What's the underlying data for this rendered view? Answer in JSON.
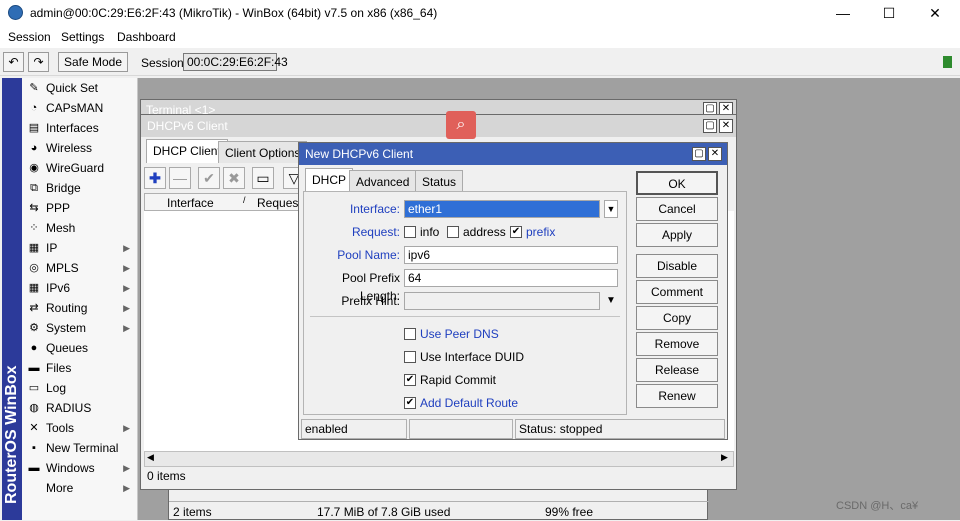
{
  "window": {
    "title": "admin@00:0C:29:E6:2F:43 (MikroTik) - WinBox (64bit) v7.5 on x86 (x86_64)",
    "minimize": "—",
    "maximize": "☐",
    "close": "✕"
  },
  "menu": [
    "Session",
    "Settings",
    "Dashboard"
  ],
  "toolbar": {
    "undo": "↶",
    "redo": "↷",
    "safe_mode": "Safe Mode",
    "session_label": "Session:",
    "session_value": "00:0C:29:E6:2F:43"
  },
  "brand_vertical": "RouterOS WinBox",
  "sidebar": [
    {
      "label": "Quick Set",
      "icon": "wand-icon",
      "glyph": "✎",
      "arrow": ""
    },
    {
      "label": "CAPsMAN",
      "icon": "capsman-icon",
      "glyph": "◔",
      "arrow": ""
    },
    {
      "label": "Interfaces",
      "icon": "interfaces-icon",
      "glyph": "▤",
      "arrow": ""
    },
    {
      "label": "Wireless",
      "icon": "wireless-icon",
      "glyph": "◕",
      "arrow": ""
    },
    {
      "label": "WireGuard",
      "icon": "wireguard-icon",
      "glyph": "◉",
      "arrow": ""
    },
    {
      "label": "Bridge",
      "icon": "bridge-icon",
      "glyph": "⧉",
      "arrow": ""
    },
    {
      "label": "PPP",
      "icon": "ppp-icon",
      "glyph": "⇆",
      "arrow": ""
    },
    {
      "label": "Mesh",
      "icon": "mesh-icon",
      "glyph": "⁘",
      "arrow": ""
    },
    {
      "label": "IP",
      "icon": "ip-icon",
      "glyph": "▦",
      "arrow": "▶"
    },
    {
      "label": "MPLS",
      "icon": "mpls-icon",
      "glyph": "◎",
      "arrow": "▶"
    },
    {
      "label": "IPv6",
      "icon": "ipv6-icon",
      "glyph": "▦",
      "arrow": "▶"
    },
    {
      "label": "Routing",
      "icon": "routing-icon",
      "glyph": "⇄",
      "arrow": "▶"
    },
    {
      "label": "System",
      "icon": "gear-icon",
      "glyph": "⚙",
      "arrow": "▶"
    },
    {
      "label": "Queues",
      "icon": "queues-icon",
      "glyph": "●",
      "arrow": ""
    },
    {
      "label": "Files",
      "icon": "files-icon",
      "glyph": "▬",
      "arrow": ""
    },
    {
      "label": "Log",
      "icon": "log-icon",
      "glyph": "▭",
      "arrow": ""
    },
    {
      "label": "RADIUS",
      "icon": "radius-icon",
      "glyph": "◍",
      "arrow": ""
    },
    {
      "label": "Tools",
      "icon": "tools-icon",
      "glyph": "✕",
      "arrow": "▶"
    },
    {
      "label": "New Terminal",
      "icon": "terminal-icon",
      "glyph": "▪",
      "arrow": ""
    },
    {
      "label": "Windows",
      "icon": "windows-icon",
      "glyph": "▬",
      "arrow": "▶"
    },
    {
      "label": "More",
      "icon": "more-icon",
      "glyph": "",
      "arrow": "▶"
    }
  ],
  "terminal": {
    "title": "Terminal <1>"
  },
  "dhcp_window": {
    "title": "DHCPv6 Client",
    "tabs": [
      "DHCP Client",
      "Client Options"
    ],
    "columns": [
      "Interface",
      "Request"
    ],
    "count": "0 items"
  },
  "bottom_window": {
    "items": "2 items",
    "used": "17.7 MiB of 7.8 GiB used",
    "free": "99% free"
  },
  "dialog": {
    "title": "New DHCPv6 Client",
    "tabs": [
      "DHCP",
      "Advanced",
      "Status"
    ],
    "interface_label": "Interface:",
    "interface_value": "ether1",
    "request_label": "Request:",
    "request_options": [
      {
        "label": "info",
        "checked": false
      },
      {
        "label": "address",
        "checked": false
      },
      {
        "label": "prefix",
        "checked": true
      }
    ],
    "pool_name_label": "Pool Name:",
    "pool_name_value": "ipv6",
    "prefix_len_label": "Pool Prefix Length:",
    "prefix_len_value": "64",
    "prefix_hint_label": "Prefix Hint:",
    "prefix_hint_value": "",
    "checkboxes": [
      {
        "label": "Use Peer DNS",
        "checked": false,
        "blue": true
      },
      {
        "label": "Use Interface DUID",
        "checked": false,
        "blue": false
      },
      {
        "label": "Rapid Commit",
        "checked": true,
        "blue": false
      },
      {
        "label": "Add Default Route",
        "checked": true,
        "blue": true
      }
    ],
    "buttons": [
      "OK",
      "Cancel",
      "Apply",
      "Disable",
      "Comment",
      "Copy",
      "Remove",
      "Release",
      "Renew"
    ],
    "status_enabled": "enabled",
    "status_middle": "",
    "status_text": "Status: stopped"
  },
  "watermark": "CSDN @H、ca¥",
  "colors": {
    "active_title": "#3c5fb5",
    "sidebar_brand": "#2c3a9a",
    "label_blue": "#1f3fbf"
  }
}
